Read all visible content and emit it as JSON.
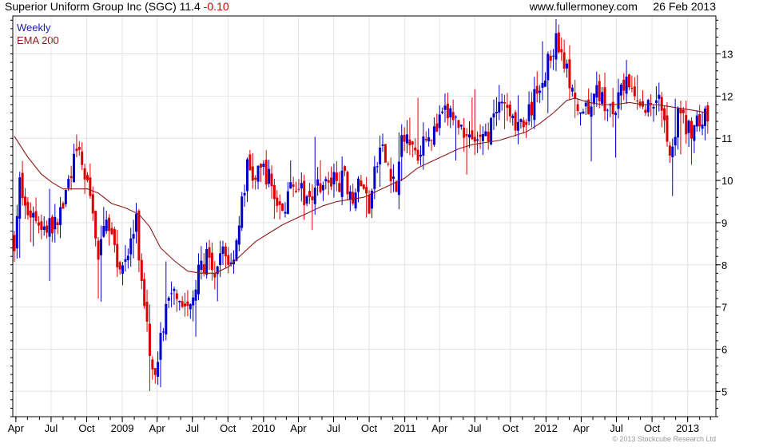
{
  "header": {
    "title": "Superior Uniform Group Inc (SGC)",
    "last": "11.4",
    "change": "-0.10",
    "site": "www.fullermoney.com",
    "date": "26 Feb 2013"
  },
  "footer": {
    "copyright": "© 2013 Stockcube Research Ltd"
  },
  "colors": {
    "up": "#0000cc",
    "down": "#dd0000",
    "ema": "#8b1a1a",
    "grid": "#e4e4e4",
    "frame": "#000000"
  },
  "chart_data": {
    "type": "candlestick-line",
    "title": "Superior Uniform Group Inc (SGC) 11.4 -0.10",
    "x_range": [
      "2008-03-24",
      "2013-03-15"
    ],
    "ylim": [
      4.4,
      13.9
    ],
    "y_ticks": [
      5,
      6,
      7,
      8,
      9,
      10,
      11,
      12,
      13
    ],
    "x_ticks": [
      {
        "label": "Apr",
        "date": "2008-04-01"
      },
      {
        "label": "Jul",
        "date": "2008-07-01"
      },
      {
        "label": "Oct",
        "date": "2008-10-01"
      },
      {
        "label": "2009",
        "date": "2009-01-01"
      },
      {
        "label": "Apr",
        "date": "2009-04-01"
      },
      {
        "label": "Jul",
        "date": "2009-07-01"
      },
      {
        "label": "Oct",
        "date": "2009-10-01"
      },
      {
        "label": "2010",
        "date": "2010-01-01"
      },
      {
        "label": "Apr",
        "date": "2010-04-01"
      },
      {
        "label": "Jul",
        "date": "2010-07-01"
      },
      {
        "label": "Oct",
        "date": "2010-10-01"
      },
      {
        "label": "2011",
        "date": "2011-01-01"
      },
      {
        "label": "Apr",
        "date": "2011-04-01"
      },
      {
        "label": "Jul",
        "date": "2011-07-01"
      },
      {
        "label": "Oct",
        "date": "2011-10-01"
      },
      {
        "label": "2012",
        "date": "2012-01-01"
      },
      {
        "label": "Apr",
        "date": "2012-04-01"
      },
      {
        "label": "Jul",
        "date": "2012-07-01"
      },
      {
        "label": "Oct",
        "date": "2012-10-01"
      },
      {
        "label": "2013",
        "date": "2013-01-01"
      }
    ],
    "grid": true,
    "legend": "top-left",
    "series": [
      {
        "name": "Weekly",
        "type": "candlestick",
        "close_path": [
          {
            "d": "2008-03-28",
            "v": 8.6
          },
          {
            "d": "2008-04-11",
            "v": 9.9
          },
          {
            "d": "2008-04-25",
            "v": 9.3
          },
          {
            "d": "2008-05-16",
            "v": 9.2
          },
          {
            "d": "2008-06-13",
            "v": 8.9
          },
          {
            "d": "2008-07-11",
            "v": 8.9
          },
          {
            "d": "2008-08-01",
            "v": 9.4
          },
          {
            "d": "2008-08-22",
            "v": 10.3
          },
          {
            "d": "2008-09-12",
            "v": 10.6
          },
          {
            "d": "2008-10-03",
            "v": 9.8
          },
          {
            "d": "2008-10-17",
            "v": 9.4
          },
          {
            "d": "2008-10-31",
            "v": 8.0
          },
          {
            "d": "2008-11-21",
            "v": 9.3
          },
          {
            "d": "2008-12-12",
            "v": 8.3
          },
          {
            "d": "2008-12-26",
            "v": 7.9
          },
          {
            "d": "2009-01-16",
            "v": 8.3
          },
          {
            "d": "2009-02-06",
            "v": 9.0
          },
          {
            "d": "2009-02-20",
            "v": 7.5
          },
          {
            "d": "2009-03-06",
            "v": 6.8
          },
          {
            "d": "2009-03-20",
            "v": 5.3
          },
          {
            "d": "2009-04-03",
            "v": 5.9
          },
          {
            "d": "2009-04-24",
            "v": 6.9
          },
          {
            "d": "2009-05-15",
            "v": 7.6
          },
          {
            "d": "2009-06-05",
            "v": 7.1
          },
          {
            "d": "2009-06-26",
            "v": 6.9
          },
          {
            "d": "2009-07-17",
            "v": 7.8
          },
          {
            "d": "2009-08-07",
            "v": 8.2
          },
          {
            "d": "2009-08-28",
            "v": 7.5
          },
          {
            "d": "2009-09-18",
            "v": 8.4
          },
          {
            "d": "2009-10-09",
            "v": 8.0
          },
          {
            "d": "2009-10-30",
            "v": 9.0
          },
          {
            "d": "2009-11-20",
            "v": 10.3
          },
          {
            "d": "2009-12-11",
            "v": 10.0
          },
          {
            "d": "2010-01-01",
            "v": 10.3
          },
          {
            "d": "2010-01-22",
            "v": 9.9
          },
          {
            "d": "2010-02-12",
            "v": 9.2
          },
          {
            "d": "2010-03-05",
            "v": 9.6
          },
          {
            "d": "2010-03-26",
            "v": 10.0
          },
          {
            "d": "2010-04-16",
            "v": 9.5
          },
          {
            "d": "2010-05-07",
            "v": 9.8
          },
          {
            "d": "2010-05-28",
            "v": 10.0
          },
          {
            "d": "2010-06-18",
            "v": 9.9
          },
          {
            "d": "2010-07-09",
            "v": 10.0
          },
          {
            "d": "2010-07-30",
            "v": 10.0
          },
          {
            "d": "2010-08-20",
            "v": 9.7
          },
          {
            "d": "2010-09-10",
            "v": 9.9
          },
          {
            "d": "2010-10-01",
            "v": 9.4
          },
          {
            "d": "2010-10-15",
            "v": 10.1
          },
          {
            "d": "2010-10-29",
            "v": 10.7
          },
          {
            "d": "2010-11-19",
            "v": 10.4
          },
          {
            "d": "2010-12-10",
            "v": 9.8
          },
          {
            "d": "2010-12-24",
            "v": 10.9
          },
          {
            "d": "2011-01-14",
            "v": 11.0
          },
          {
            "d": "2011-02-04",
            "v": 10.7
          },
          {
            "d": "2011-02-25",
            "v": 11.2
          },
          {
            "d": "2011-03-18",
            "v": 11.1
          },
          {
            "d": "2011-04-08",
            "v": 11.5
          },
          {
            "d": "2011-04-29",
            "v": 11.6
          },
          {
            "d": "2011-05-20",
            "v": 11.3
          },
          {
            "d": "2011-06-10",
            "v": 11.2
          },
          {
            "d": "2011-07-01",
            "v": 11.0
          },
          {
            "d": "2011-07-22",
            "v": 10.9
          },
          {
            "d": "2011-08-12",
            "v": 11.3
          },
          {
            "d": "2011-09-02",
            "v": 11.6
          },
          {
            "d": "2011-09-23",
            "v": 11.8
          },
          {
            "d": "2011-10-14",
            "v": 11.4
          },
          {
            "d": "2011-11-04",
            "v": 11.3
          },
          {
            "d": "2011-11-25",
            "v": 11.7
          },
          {
            "d": "2011-12-16",
            "v": 12.3
          },
          {
            "d": "2012-01-06",
            "v": 12.8
          },
          {
            "d": "2012-01-27",
            "v": 13.3
          },
          {
            "d": "2012-02-10",
            "v": 13.1
          },
          {
            "d": "2012-02-24",
            "v": 12.6
          },
          {
            "d": "2012-03-16",
            "v": 11.7
          },
          {
            "d": "2012-04-06",
            "v": 11.4
          },
          {
            "d": "2012-04-27",
            "v": 11.9
          },
          {
            "d": "2012-05-18",
            "v": 12.1
          },
          {
            "d": "2012-06-08",
            "v": 11.6
          },
          {
            "d": "2012-06-29",
            "v": 11.7
          },
          {
            "d": "2012-07-20",
            "v": 12.3
          },
          {
            "d": "2012-08-10",
            "v": 12.0
          },
          {
            "d": "2012-08-31",
            "v": 11.7
          },
          {
            "d": "2012-09-21",
            "v": 11.8
          },
          {
            "d": "2012-10-12",
            "v": 12.1
          },
          {
            "d": "2012-11-02",
            "v": 11.6
          },
          {
            "d": "2012-11-16",
            "v": 10.6
          },
          {
            "d": "2012-12-07",
            "v": 11.6
          },
          {
            "d": "2012-12-28",
            "v": 11.2
          },
          {
            "d": "2013-01-18",
            "v": 11.3
          },
          {
            "d": "2013-02-08",
            "v": 11.5
          },
          {
            "d": "2013-02-22",
            "v": 11.4
          }
        ]
      },
      {
        "name": "EMA 200",
        "type": "line",
        "points": [
          {
            "d": "2008-03-28",
            "v": 11.05
          },
          {
            "d": "2008-05-02",
            "v": 10.55
          },
          {
            "d": "2008-06-06",
            "v": 10.15
          },
          {
            "d": "2008-07-04",
            "v": 9.95
          },
          {
            "d": "2008-08-01",
            "v": 9.8
          },
          {
            "d": "2008-09-05",
            "v": 9.8
          },
          {
            "d": "2008-10-03",
            "v": 9.8
          },
          {
            "d": "2008-10-31",
            "v": 9.7
          },
          {
            "d": "2008-12-05",
            "v": 9.45
          },
          {
            "d": "2009-01-09",
            "v": 9.35
          },
          {
            "d": "2009-02-13",
            "v": 9.2
          },
          {
            "d": "2009-03-13",
            "v": 8.9
          },
          {
            "d": "2009-04-10",
            "v": 8.4
          },
          {
            "d": "2009-05-15",
            "v": 8.1
          },
          {
            "d": "2009-06-19",
            "v": 7.85
          },
          {
            "d": "2009-07-24",
            "v": 7.8
          },
          {
            "d": "2009-08-28",
            "v": 7.8
          },
          {
            "d": "2009-10-02",
            "v": 7.95
          },
          {
            "d": "2009-11-06",
            "v": 8.25
          },
          {
            "d": "2009-12-11",
            "v": 8.55
          },
          {
            "d": "2010-01-15",
            "v": 8.75
          },
          {
            "d": "2010-02-19",
            "v": 8.95
          },
          {
            "d": "2010-03-26",
            "v": 9.1
          },
          {
            "d": "2010-04-30",
            "v": 9.25
          },
          {
            "d": "2010-06-04",
            "v": 9.4
          },
          {
            "d": "2010-07-09",
            "v": 9.5
          },
          {
            "d": "2010-08-13",
            "v": 9.55
          },
          {
            "d": "2010-09-17",
            "v": 9.6
          },
          {
            "d": "2010-10-22",
            "v": 9.75
          },
          {
            "d": "2010-11-26",
            "v": 9.9
          },
          {
            "d": "2010-12-31",
            "v": 10.05
          },
          {
            "d": "2011-02-04",
            "v": 10.3
          },
          {
            "d": "2011-03-11",
            "v": 10.45
          },
          {
            "d": "2011-04-15",
            "v": 10.6
          },
          {
            "d": "2011-05-20",
            "v": 10.75
          },
          {
            "d": "2011-06-24",
            "v": 10.85
          },
          {
            "d": "2011-07-29",
            "v": 10.9
          },
          {
            "d": "2011-09-02",
            "v": 10.95
          },
          {
            "d": "2011-10-07",
            "v": 11.05
          },
          {
            "d": "2011-11-11",
            "v": 11.15
          },
          {
            "d": "2011-12-16",
            "v": 11.35
          },
          {
            "d": "2012-01-20",
            "v": 11.6
          },
          {
            "d": "2012-02-24",
            "v": 11.9
          },
          {
            "d": "2012-03-16",
            "v": 11.95
          },
          {
            "d": "2012-04-20",
            "v": 11.85
          },
          {
            "d": "2012-05-25",
            "v": 11.8
          },
          {
            "d": "2012-06-29",
            "v": 11.8
          },
          {
            "d": "2012-08-03",
            "v": 11.85
          },
          {
            "d": "2012-09-07",
            "v": 11.8
          },
          {
            "d": "2012-10-12",
            "v": 11.8
          },
          {
            "d": "2012-11-16",
            "v": 11.75
          },
          {
            "d": "2012-12-21",
            "v": 11.7
          },
          {
            "d": "2013-01-25",
            "v": 11.65
          },
          {
            "d": "2013-02-22",
            "v": 11.6
          }
        ]
      }
    ]
  }
}
